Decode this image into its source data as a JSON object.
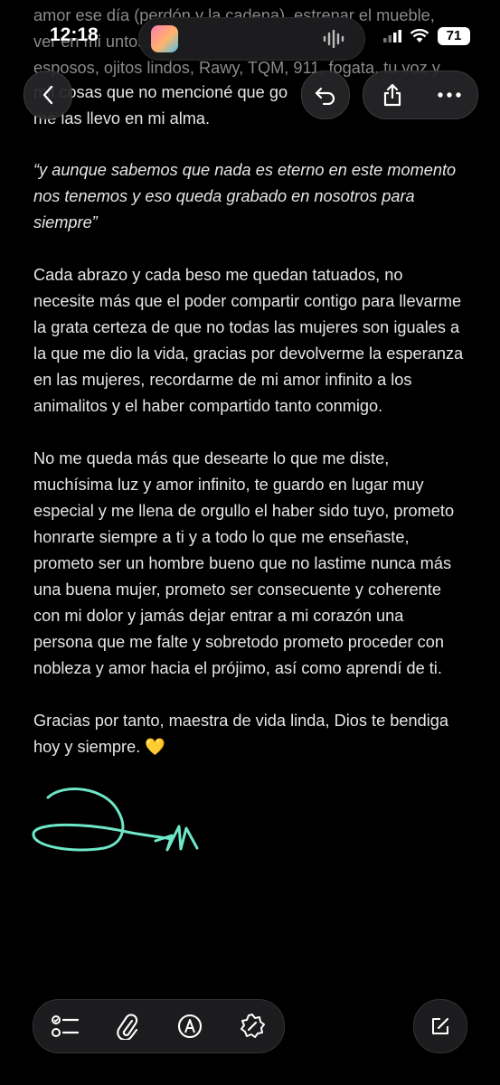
{
  "status_bar": {
    "time": "12:18",
    "battery": "71",
    "icons": [
      "cellular-icon",
      "wifi-icon",
      "battery-icon"
    ]
  },
  "note": {
    "partial_lines": [
      "amor ese día (perdón y la cadena), estrenar el mueble,",
      "ver                  en mi                                             untos con",
      "esposos, ojitos lindos, Rawy, TQM, 911, fogata, tu voz y",
      "         mil cosas que no mencioné que                     go",
      "me las llevo en mi alma."
    ],
    "quote": "“y aunque sabemos que nada es eterno en este momento nos tenemos y eso queda grabado en nosotros para siempre”",
    "paragraph_2": "Cada abrazo y cada beso me quedan tatuados, no necesite más que el poder compartir contigo para llevarme la grata certeza de que no todas las mujeres son iguales a la que me dio la vida, gracias por devolverme la esperanza en las mujeres, recordarme de mi amor infinito a los animalitos y el haber compartido tanto conmigo.",
    "paragraph_3": "No me queda más que desearte lo que me diste, muchísima luz y amor infinito, te guardo en lugar muy especial y me llena de orgullo el haber sido tuyo, prometo honrarte siempre a ti y a todo lo que me enseñaste, prometo ser un hombre bueno que no lastime nunca más una buena mujer, prometo ser consecuente y coherente con mi dolor y jamás dejar entrar a mi corazón una persona que me falte y sobretodo prometo proceder con nobleza y amor hacia el prójimo, así como aprendí de ti.",
    "paragraph_4": "Gracias por tanto, maestra de vida linda, Dios te bendiga hoy y siempre. 💛"
  },
  "colors": {
    "background": "#000000",
    "text": "#e6e6e6",
    "signature": "#6ee7c8",
    "heart": "#f5c518"
  },
  "toolbar": {
    "icons": [
      "checklist-icon",
      "attachment-icon",
      "markup-icon",
      "writing-tools-icon"
    ],
    "compose_icon": "compose-icon"
  },
  "nav": {
    "icons": [
      "back-icon",
      "undo-icon",
      "share-icon",
      "more-icon"
    ]
  }
}
